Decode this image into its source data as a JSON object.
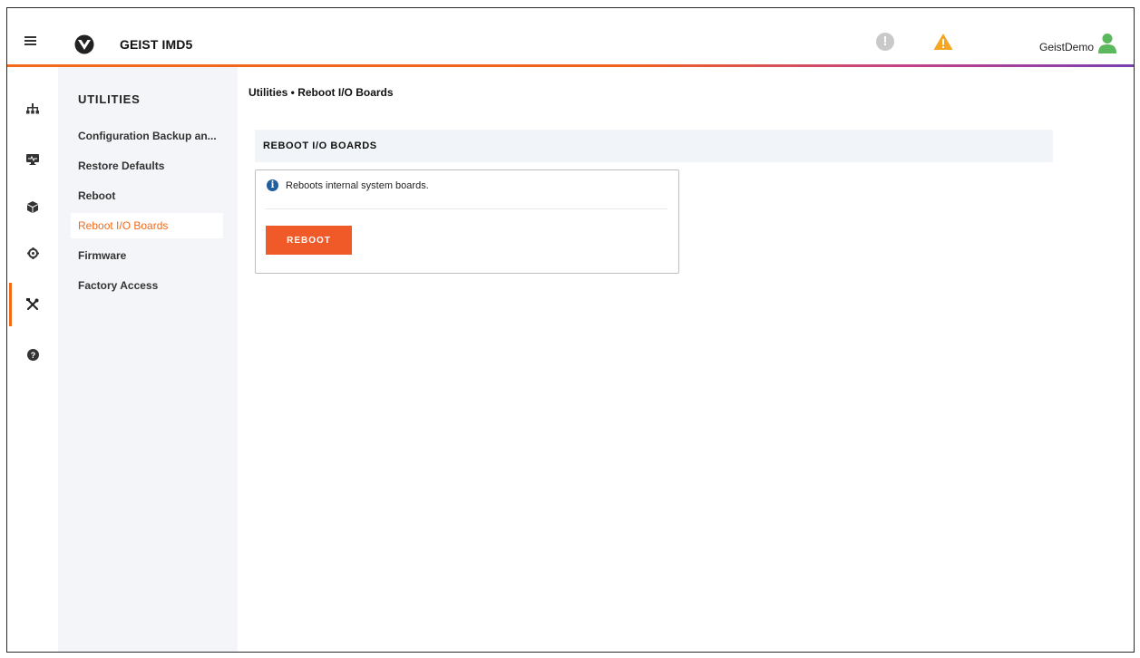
{
  "header": {
    "app_title": "GEIST IMD5",
    "alarm_symbol": "!",
    "user_name": "GeistDemo",
    "icons": [
      "menu-icon",
      "vertiv-logo-icon",
      "alarm-icon",
      "warning-icon",
      "user-icon"
    ],
    "colors": {
      "accent": "#f26a1b",
      "warning": "#f5a623",
      "user": "#5cb85c",
      "alarm": "#c9c9c9"
    }
  },
  "rail": {
    "items": [
      {
        "name": "network-icon"
      },
      {
        "name": "monitor-icon"
      },
      {
        "name": "box-icon"
      },
      {
        "name": "settings-gear-icon"
      },
      {
        "name": "tools-icon",
        "active": true
      },
      {
        "name": "help-icon"
      }
    ]
  },
  "sidebar": {
    "title": "UTILITIES",
    "items": [
      {
        "label": "Configuration Backup an..."
      },
      {
        "label": "Restore Defaults"
      },
      {
        "label": "Reboot"
      },
      {
        "label": "Reboot I/O Boards",
        "active": true
      },
      {
        "label": "Firmware"
      },
      {
        "label": "Factory Access"
      }
    ]
  },
  "main": {
    "breadcrumb": "Utilities • Reboot I/O Boards",
    "section_title": "REBOOT I/O BOARDS",
    "info_symbol": "i",
    "info_text": "Reboots internal system boards.",
    "reboot_button_label": "REBOOT",
    "button_color": "#f05a28"
  }
}
